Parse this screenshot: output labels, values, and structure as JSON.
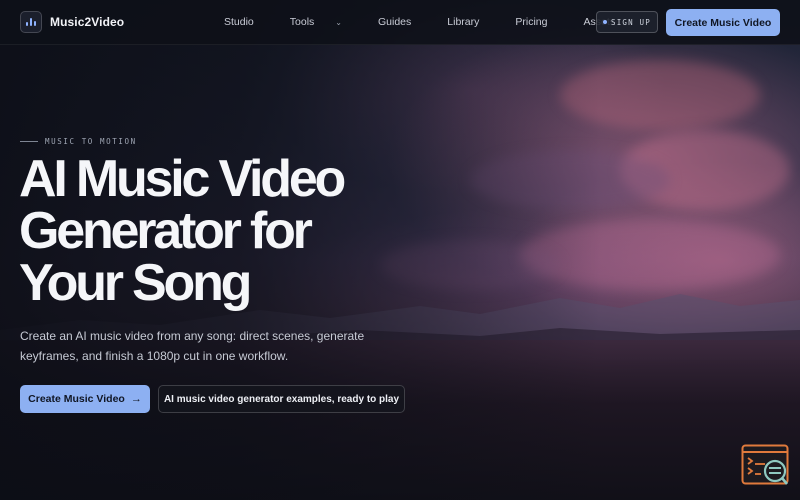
{
  "header": {
    "brand": "Music2Video",
    "nav": [
      {
        "label": "Studio",
        "has_dropdown": false
      },
      {
        "label": "Tools",
        "has_dropdown": true
      },
      {
        "label": "Guides",
        "has_dropdown": false
      },
      {
        "label": "Library",
        "has_dropdown": false
      },
      {
        "label": "Pricing",
        "has_dropdown": false
      },
      {
        "label": "Assets",
        "has_dropdown": false
      }
    ],
    "signup_label": "SIGN UP",
    "cta_label": "Create Music Video"
  },
  "hero": {
    "eyebrow": "MUSIC TO MOTION",
    "headline_lines": [
      "AI Music Video",
      "Generator for",
      "Your Song"
    ],
    "subtitle": "Create an AI music video from any song: direct scenes, generate keyframes, and finish a 1080p cut in one workflow.",
    "primary_button": "Create Music Video",
    "secondary_button": "AI music video generator examples, ready to play"
  },
  "icons": {
    "logo": "bar-chart-logo-icon",
    "primary_arrow": "arrow-right-icon",
    "dropdown": "chevron-down-icon",
    "widget": "terminal-search-icon"
  },
  "colors": {
    "accent": "#8db0f2",
    "background": "#151824",
    "widget": "#e07a3c"
  }
}
